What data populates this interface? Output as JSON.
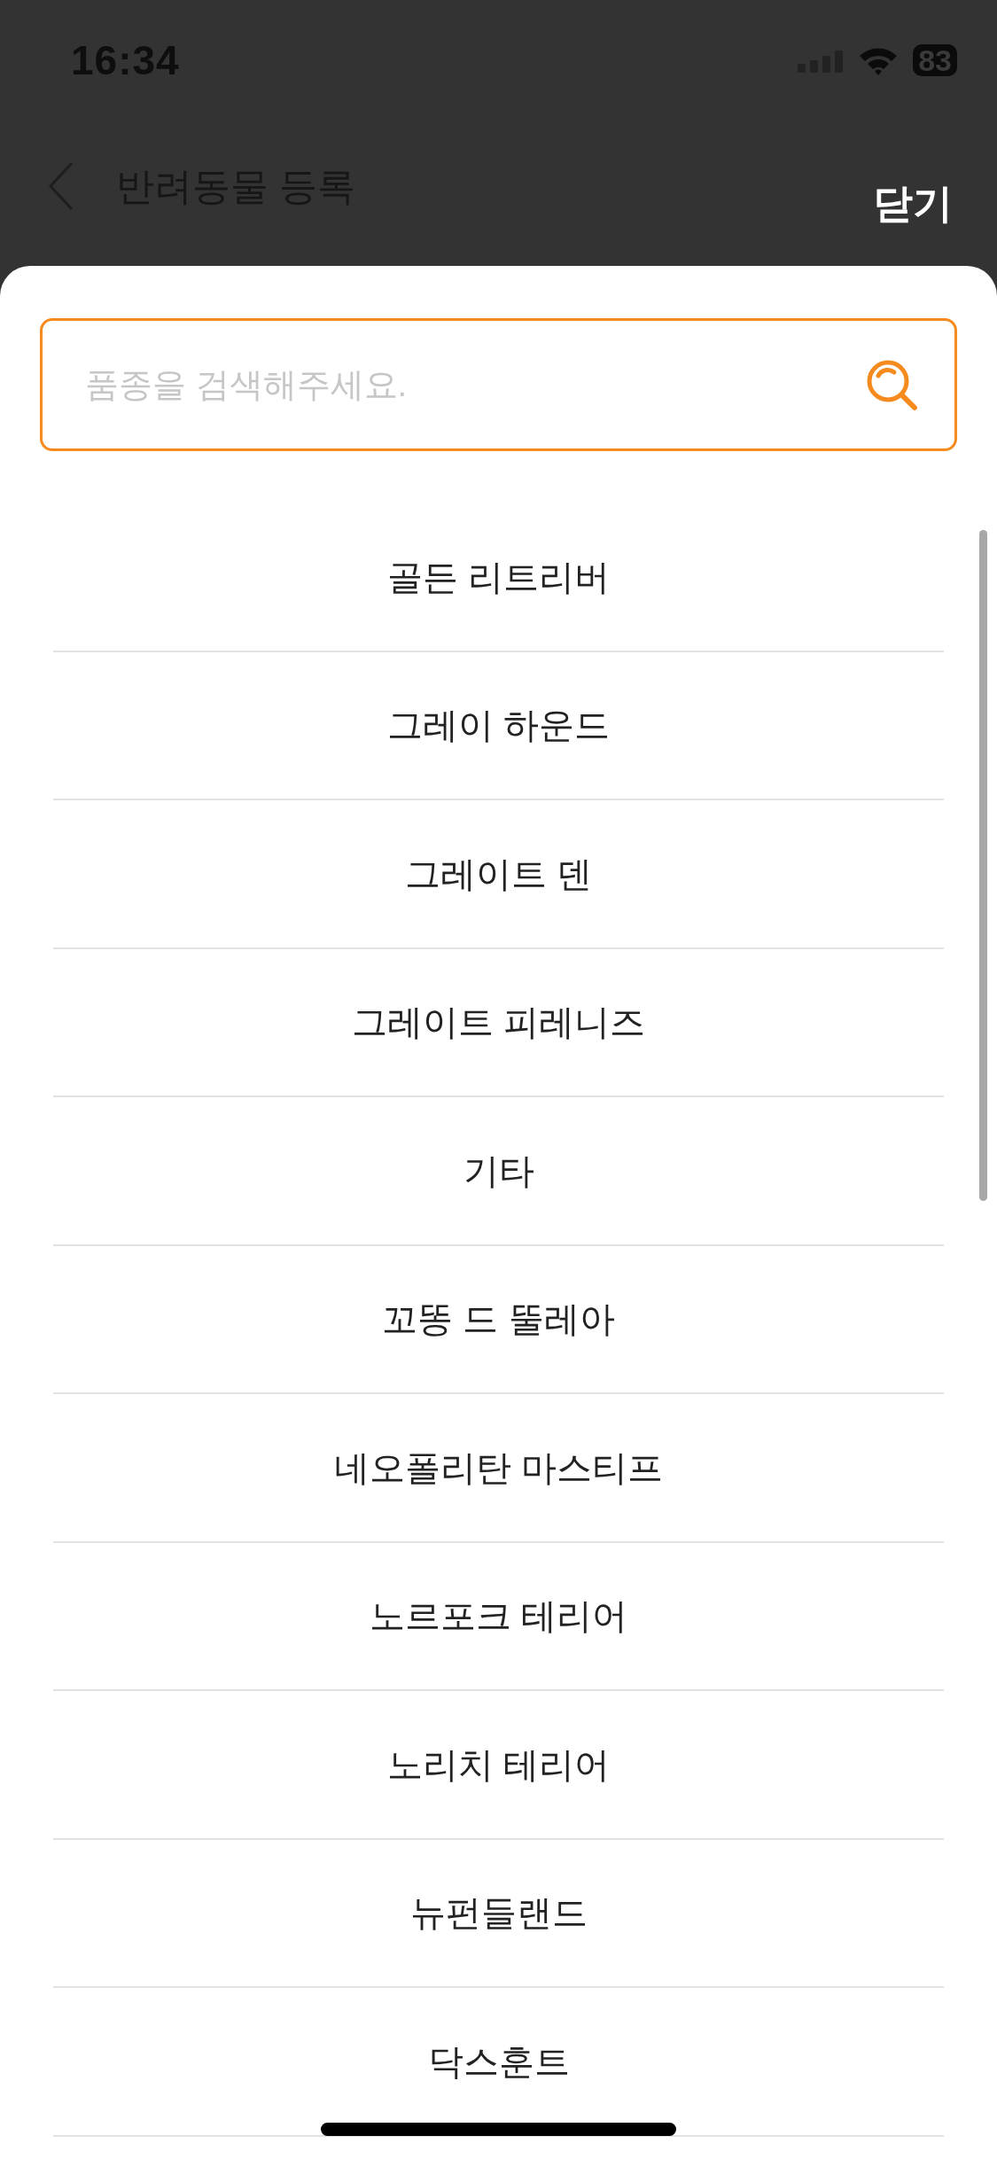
{
  "status_bar": {
    "time": "16:34",
    "battery": "83"
  },
  "nav_bar": {
    "title": "반려동물 등록",
    "close_label": "닫기"
  },
  "search": {
    "placeholder": "품종을 검색해주세요."
  },
  "breeds": [
    "골든 리트리버",
    "그레이 하운드",
    "그레이트 덴",
    "그레이트 피레니즈",
    "기타",
    "꼬똥 드 뚤레아",
    "네오폴리탄 마스티프",
    "노르포크 테리어",
    "노리치 테리어",
    "뉴펀들랜드",
    "닥스훈트"
  ]
}
